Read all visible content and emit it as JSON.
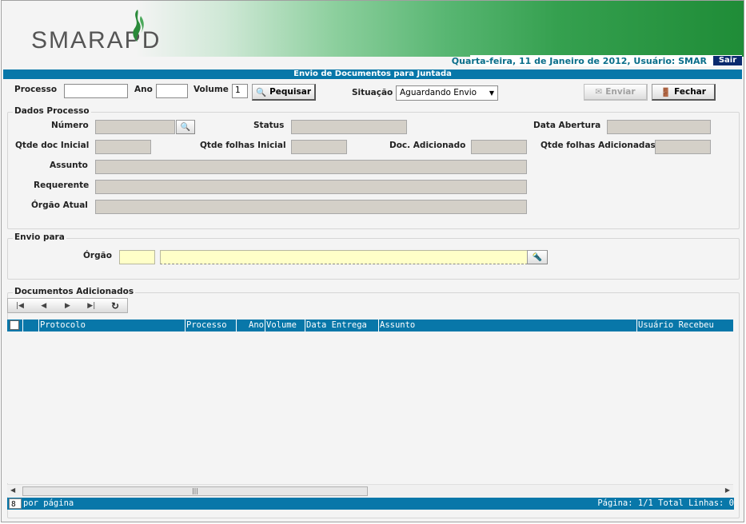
{
  "brand": {
    "logo_text": "SMARAPD",
    "logo_color": "#555555",
    "accent": "#0877a9"
  },
  "userbar": {
    "text": "Quarta-feira, 11 de Janeiro de 2012, Usuário: SMAR",
    "logout": "Sair"
  },
  "page_title": "Envio de Documentos para Juntada",
  "search": {
    "processo_label": "Processo",
    "processo_value": "",
    "ano_label": "Ano",
    "ano_value": "",
    "volume_label": "Volume",
    "volume_value": "1",
    "search_button": "Pequisar",
    "situacao_label": "Situação",
    "situacao_value": "Aguardando Envio"
  },
  "actions": {
    "send": "Enviar",
    "close": "Fechar"
  },
  "dados_processo": {
    "legend": "Dados Processo",
    "numero": "Número",
    "status": "Status",
    "data_abertura": "Data Abertura",
    "qtde_doc_inicial": "Qtde doc Inicial",
    "qtde_folhas_inicial": "Qtde folhas Inicial",
    "doc_adicionado": "Doc. Adicionado",
    "qtde_folhas_adicionadas": "Qtde folhas Adicionadas",
    "assunto": "Assunto",
    "requerente": "Requerente",
    "orgao_atual": "Órgão Atual"
  },
  "envio_para": {
    "legend": "Envio para",
    "orgao_label": "Órgão",
    "orgao_code": "",
    "orgao_name": ""
  },
  "documentos": {
    "legend": "Documentos Adicionados",
    "columns": [
      "Protocolo",
      "Processo",
      "Ano",
      "Volume",
      "Data Entrega",
      "Assunto",
      "Usuário Recebeu"
    ],
    "rows": [],
    "per_page_value": "8",
    "per_page_label": "por página",
    "status": "Página: 1/1 Total Linhas: 0"
  }
}
